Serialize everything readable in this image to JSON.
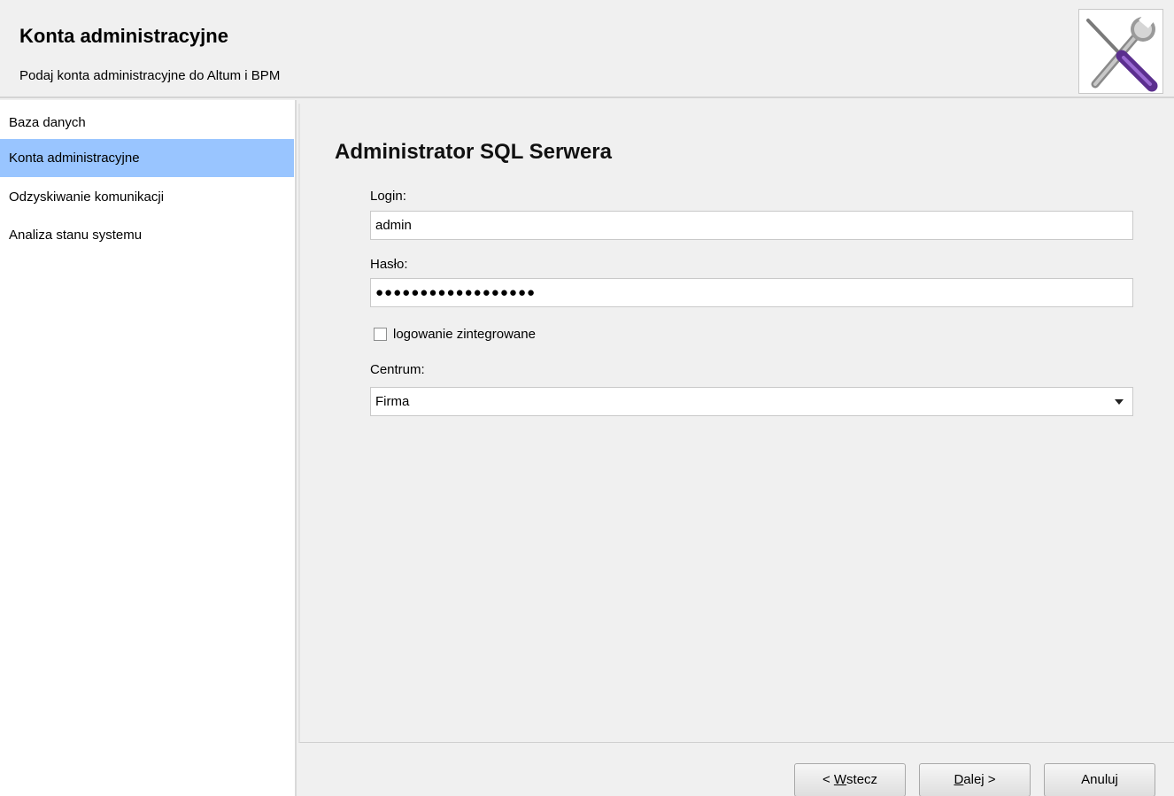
{
  "header": {
    "title": "Konta administracyjne",
    "subtitle": "Podaj konta administracyjne do Altum i BPM",
    "logo_icon": "tools-icon"
  },
  "sidebar": {
    "items": [
      {
        "label": "Baza danych",
        "selected": false
      },
      {
        "label": "Konta administracyjne",
        "selected": true
      },
      {
        "label": "Odzyskiwanie komunikacji",
        "selected": false
      },
      {
        "label": "Analiza stanu systemu",
        "selected": false
      }
    ],
    "selected_color": "#99c5ff"
  },
  "main": {
    "section_title": "Administrator SQL Serwera",
    "login": {
      "label": "Login:",
      "value": "admin"
    },
    "password": {
      "label": "Hasło:",
      "value": "●●●●●●●●●●●●●●●●●●"
    },
    "integrated_login": {
      "label": "logowanie zintegrowane",
      "checked": false
    },
    "centrum": {
      "label": "Centrum:",
      "selected": "Firma"
    }
  },
  "footer": {
    "back_prefix": "< ",
    "back_mnemonic": "W",
    "back_rest": "stecz",
    "next_mnemonic": "D",
    "next_rest": "alej >",
    "cancel_label": "Anuluj"
  }
}
